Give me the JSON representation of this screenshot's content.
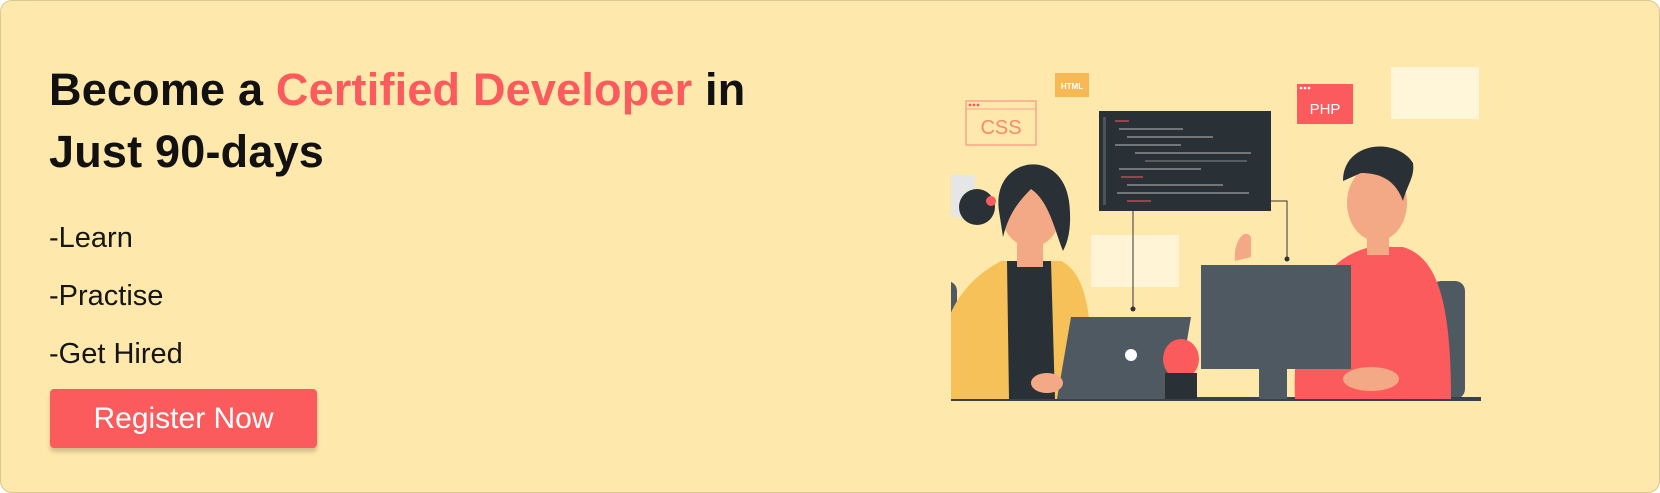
{
  "headline": {
    "line1_before": "Become a ",
    "line1_accent": "Certified Developer",
    "line1_after": " in",
    "line2": "Just 90-days"
  },
  "features": [
    "-Learn",
    "-Practise",
    "-Get Hired"
  ],
  "cta": {
    "label": "Register Now"
  },
  "illustration": {
    "badges": {
      "css": "CSS",
      "html": "HTML",
      "php": "PHP"
    }
  },
  "colors": {
    "background": "#ffe8ab",
    "accent": "#fb5b5d",
    "text": "#111111",
    "button_text": "#ffffff"
  }
}
